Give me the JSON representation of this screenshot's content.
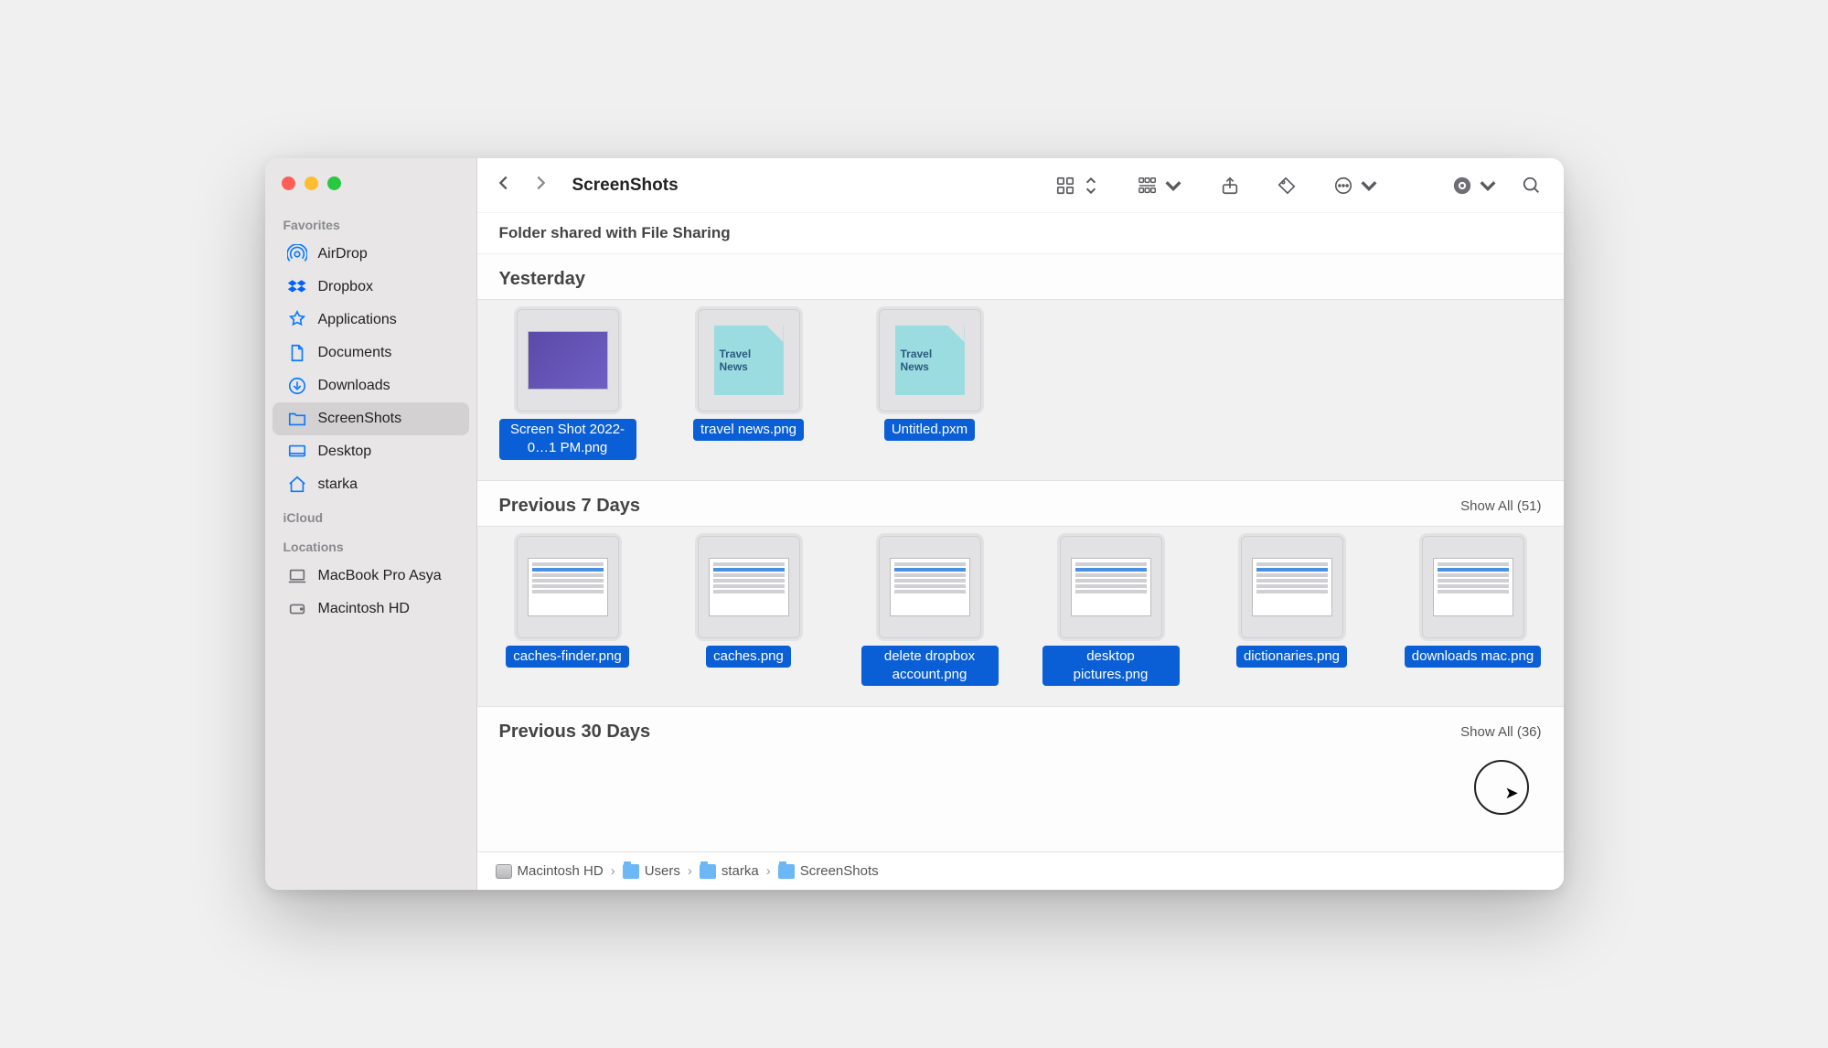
{
  "window": {
    "title": "ScreenShots"
  },
  "subbar": {
    "text": "Folder shared with File Sharing"
  },
  "sidebar": {
    "sections": [
      {
        "heading": "Favorites",
        "items": [
          {
            "label": "AirDrop",
            "icon": "airdrop"
          },
          {
            "label": "Dropbox",
            "icon": "dropbox"
          },
          {
            "label": "Applications",
            "icon": "applications"
          },
          {
            "label": "Documents",
            "icon": "document"
          },
          {
            "label": "Downloads",
            "icon": "downloads"
          },
          {
            "label": "ScreenShots",
            "icon": "folder",
            "selected": true
          },
          {
            "label": "Desktop",
            "icon": "desktop"
          },
          {
            "label": "starka",
            "icon": "home"
          }
        ]
      },
      {
        "heading": "iCloud",
        "items": []
      },
      {
        "heading": "Locations",
        "items": [
          {
            "label": "MacBook Pro Asya",
            "icon": "laptop",
            "loc": true
          },
          {
            "label": "Macintosh HD",
            "icon": "disk",
            "loc": true
          }
        ]
      }
    ]
  },
  "groups": [
    {
      "title": "Yesterday",
      "showAll": null,
      "files": [
        {
          "name": "Screen Shot 2022-0…1 PM.png",
          "thumb": "purple"
        },
        {
          "name": "travel news.png",
          "thumb": "sticky",
          "sticky_text": "Travel News"
        },
        {
          "name": "Untitled.pxm",
          "thumb": "sticky",
          "sticky_text": "Travel News"
        }
      ]
    },
    {
      "title": "Previous 7 Days",
      "showAll": "Show All (51)",
      "files": [
        {
          "name": "caches-finder.png",
          "thumb": "mini"
        },
        {
          "name": "caches.png",
          "thumb": "mini"
        },
        {
          "name": "delete dropbox account.png",
          "thumb": "mini"
        },
        {
          "name": "desktop pictures.png",
          "thumb": "mini"
        },
        {
          "name": "dictionaries.png",
          "thumb": "mini"
        },
        {
          "name": "downloads mac.png",
          "thumb": "mini"
        }
      ]
    },
    {
      "title": "Previous 30 Days",
      "showAll": "Show All (36)",
      "files": []
    }
  ],
  "pathbar": [
    {
      "label": "Macintosh HD",
      "icon": "disk"
    },
    {
      "label": "Users",
      "icon": "folder"
    },
    {
      "label": "starka",
      "icon": "folder"
    },
    {
      "label": "ScreenShots",
      "icon": "folder"
    }
  ]
}
